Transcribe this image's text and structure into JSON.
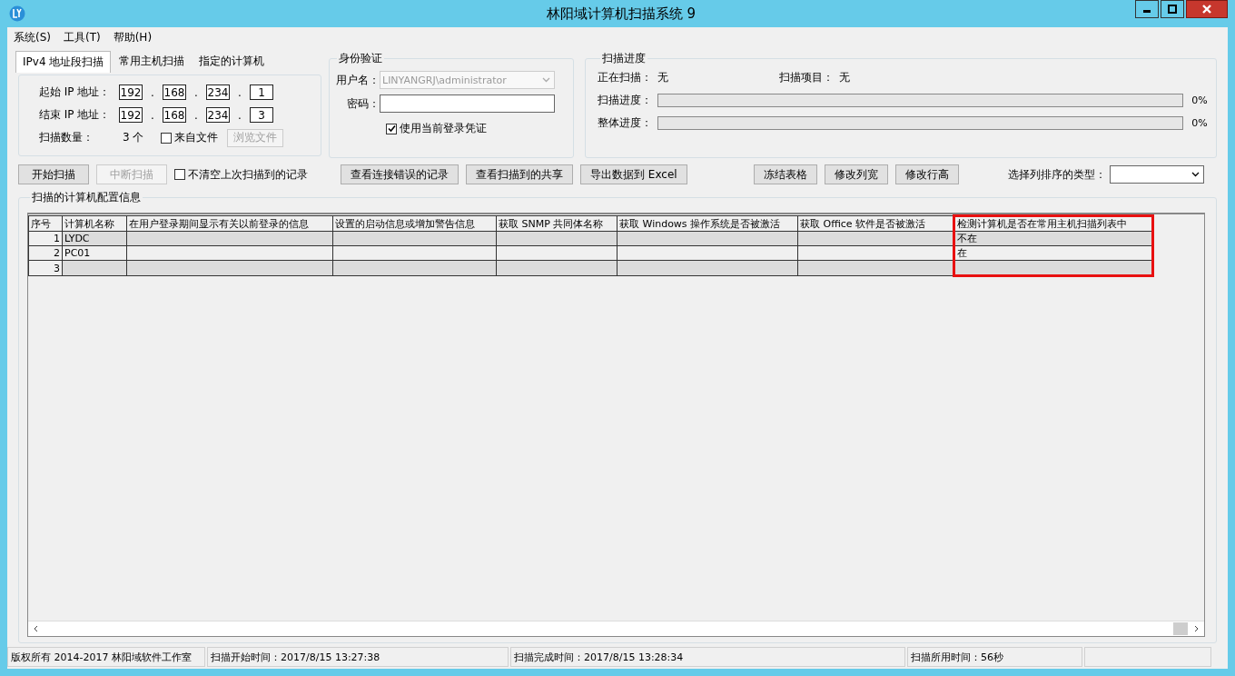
{
  "window": {
    "title": "林阳域计算机扫描系统 9"
  },
  "menu": [
    "系统(S)",
    "工具(T)",
    "帮助(H)"
  ],
  "scan_tabs": [
    {
      "label": "IPv4 地址段扫描",
      "selected": true
    },
    {
      "label": "常用主机扫描",
      "selected": false
    },
    {
      "label": "指定的计算机",
      "selected": false
    }
  ],
  "ip_range": {
    "start_label": "起始 IP 地址：",
    "start": [
      "192",
      "168",
      "234",
      "1"
    ],
    "end_label": "结束 IP 地址：",
    "end": [
      "192",
      "168",
      "234",
      "3"
    ],
    "separator": ".",
    "count_label": "扫描数量：",
    "count": "3 个",
    "from_file": {
      "label": "来自文件",
      "checked": false
    },
    "browse": {
      "label": "浏览文件",
      "disabled": true
    }
  },
  "auth": {
    "title": "身份验证",
    "username_label": "用户名：",
    "username": "LINYANGRJ\\administrator",
    "username_disabled": true,
    "password_label": "密码：",
    "use_current": {
      "label": "使用当前登录凭证",
      "checked": true
    }
  },
  "progress": {
    "title": "扫描进度",
    "scanning_label": "正在扫描：",
    "scanning": "无",
    "item_label": "扫描项目：",
    "item": "无",
    "bars": [
      {
        "label": "扫描进度：",
        "level": 0,
        "reading": "0%"
      },
      {
        "label": "整体进度：",
        "level": 0,
        "reading": "0%"
      }
    ]
  },
  "toolbar_left": [
    {
      "kind": "button",
      "label": "开始扫描",
      "disabled": false
    },
    {
      "kind": "button",
      "label": "中断扫描",
      "disabled": true
    },
    {
      "kind": "checkbox",
      "label": "不清空上次扫描到的记录",
      "checked": false
    }
  ],
  "toolbar_mid": [
    "查看连接错误的记录",
    "查看扫描到的共享",
    "导出数据到 Excel"
  ],
  "toolbar_right": [
    "冻结表格",
    "修改列宽",
    "修改行高"
  ],
  "sort_label": "选择列排序的类型：",
  "table": {
    "title": "扫描的计算机配置信息",
    "columns": [
      {
        "label": "序号",
        "highlighted": false
      },
      {
        "label": "计算机名称",
        "highlighted": false
      },
      {
        "label": "在用户登录期间显示有关以前登录的信息",
        "highlighted": false
      },
      {
        "label": "设置的启动信息或增加警告信息",
        "highlighted": false
      },
      {
        "label": "获取 SNMP 共同体名称",
        "highlighted": false
      },
      {
        "label": "获取 Windows 操作系统是否被激活",
        "highlighted": false
      },
      {
        "label": "获取 Office 软件是否被激活",
        "highlighted": false
      },
      {
        "label": "检测计算机是否在常用主机扫描列表中",
        "highlighted": true
      }
    ],
    "rows": [
      {
        "number": "1",
        "name": "LYDC",
        "in_list": "不在"
      },
      {
        "number": "2",
        "name": "PC01",
        "in_list": "在"
      },
      {
        "number": "3"
      }
    ]
  },
  "status_bar": [
    "版权所有 2014-2017 林阳域软件工作室",
    "扫描开始时间：2017/8/15 13:27:38",
    "扫描完成时间：2017/8/15 13:28:34",
    "扫描所用时间：56秒"
  ]
}
